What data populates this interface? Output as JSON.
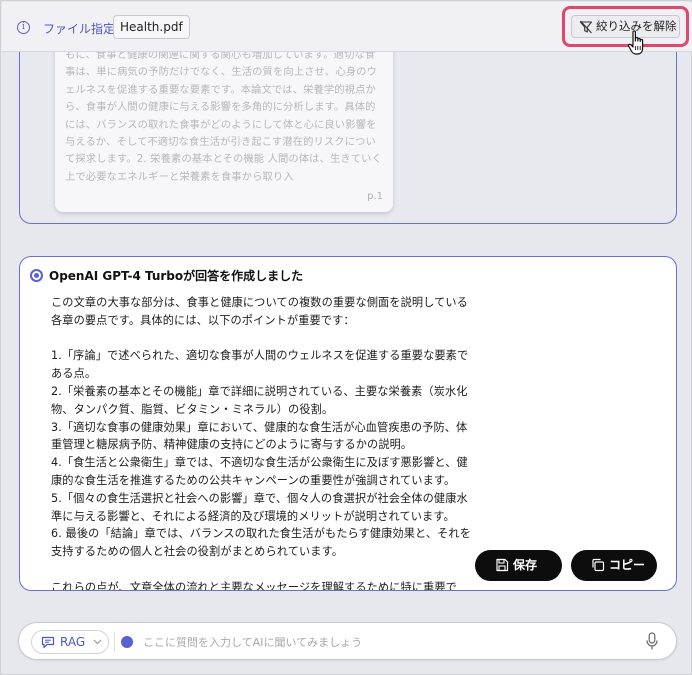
{
  "topbar": {
    "file_label": "ファイル指定",
    "file_name": "Health.pdf",
    "unfilter_label": "絞り込みを解除"
  },
  "source_page": {
    "text": "もに、食事と健康の関連に関する関心も増加しています。適切な食事は、単に病気の予防だけでなく、生活の質を向上させ、心身のウェルネスを促進する重要な要素です。本論文では、栄養学的視点から、食事が人間の健康に与える影響を多角的に分析します。具体的には、バランスの取れた食事がどのようにして体と心に良い影響を与えるか、そして不適切な食生活が引き起こす潜在的リスクについて探求します。2. 栄養素の基本とその機能 人間の体は、生きていく上で必要なエネルギーと栄養素を食事から取り入",
    "page_number": "p.1"
  },
  "answer": {
    "title": "OpenAI GPT-4 Turboが回答を作成しました",
    "intro": "この文章の大事な部分は、食事と健康についての複数の重要な側面を説明している各章の要点です。具体的には、以下のポイントが重要です：",
    "points": [
      "1.「序論」で述べられた、適切な食事が人間のウェルネスを促進する重要な要素である点。",
      "2.「栄養素の基本とその機能」章で詳細に説明されている、主要な栄養素（炭水化物、タンパク質、脂質、ビタミン・ミネラル）の役割。",
      "3.「適切な食事の健康効果」章において、健康的な食生活が心血管疾患の予防、体重管理と糖尿病予防、精神健康の支持にどのように寄与するかの説明。",
      "4.「食生活と公衆衛生」章では、不適切な食生活が公衆衛生に及ぼす悪影響と、健康的な食生活を推進するための公共キャンペーンの重要性が強調されています。",
      "5.「個々の食生活選択と社会への影響」章で、個々人の食選択が社会全体の健康水準に与える影響と、それによる経済的及び環境的メリットが説明されています。",
      "6. 最後の「結論」章では、バランスの取れた食生活がもたらす健康効果と、それを支持するための個人と社会の役割がまとめられています。"
    ],
    "conclusion": "これらの点が、文章全体の流れと主要なメッセージを理解するために特に重要です。",
    "save_label": "保存",
    "copy_label": "コピー"
  },
  "input": {
    "mode_label": "RAG",
    "placeholder": "ここに質問を入力してAIに聞いてみましょう"
  },
  "colors": {
    "accent": "#5a5fd1",
    "highlight": "#e2476a"
  }
}
